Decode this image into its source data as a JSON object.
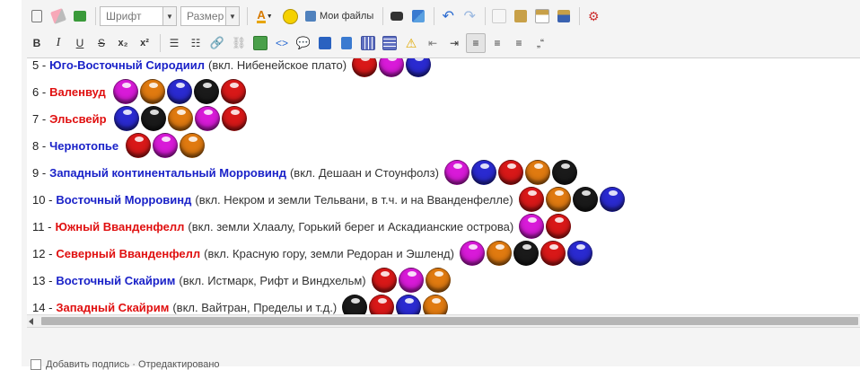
{
  "toolbar1": {
    "font_placeholder": "Шрифт",
    "size_placeholder": "Размер",
    "my_files_label": "Мои файлы"
  },
  "toolbar2": {
    "bold": "B",
    "italic": "I",
    "underline": "U",
    "strike": "S",
    "subscript": "x₂",
    "superscript": "x²",
    "quote": "„“"
  },
  "colors": {
    "red": "#d81818",
    "magenta": "#d81ad8",
    "blue": "#2a2ad0",
    "orange": "#e07a10",
    "black": "#1a1a1a",
    "name_blue": "#1a22c8",
    "name_red": "#e01010"
  },
  "lines": [
    {
      "num": "5 - ",
      "name": "Юго-Восточный Сиродиил",
      "color": "blue",
      "note": " (вкл. Нибенейское плато)",
      "balls": [
        "red",
        "magenta",
        "blue"
      ]
    },
    {
      "num": "6 - ",
      "name": "Валенвуд",
      "color": "red",
      "note": "",
      "balls": [
        "magenta",
        "orange",
        "blue",
        "black",
        "red"
      ]
    },
    {
      "num": "7 - ",
      "name": "Эльсвейр",
      "color": "red",
      "note": "",
      "balls": [
        "blue",
        "black",
        "orange",
        "magenta",
        "red"
      ]
    },
    {
      "num": "8 - ",
      "name": "Чернотопье",
      "color": "blue",
      "note": "",
      "balls": [
        "red",
        "magenta",
        "orange"
      ]
    },
    {
      "num": "9 - ",
      "name": "Западный континентальный Морровинд",
      "color": "blue",
      "note": " (вкл. Дешаан и Стоунфолз)",
      "balls": [
        "magenta",
        "blue",
        "red",
        "orange",
        "black"
      ]
    },
    {
      "num": "10 - ",
      "name": "Восточный Морровинд",
      "color": "blue",
      "note": " (вкл. Некром и земли Тельвани, в т.ч. и на Вванденфелле)",
      "balls": [
        "red",
        "orange",
        "black",
        "blue"
      ]
    },
    {
      "num": "11 - ",
      "name": "Южный Вванденфелл",
      "color": "red",
      "note": " (вкл. земли Хлаалу, Горький берег и Аскадианские острова)",
      "balls": [
        "magenta",
        "red"
      ]
    },
    {
      "num": "12 - ",
      "name": "Северный Вванденфелл",
      "color": "red",
      "note": " (вкл. Красную гору, земли Редоран и Эшленд)",
      "balls": [
        "magenta",
        "orange",
        "black",
        "red",
        "blue"
      ]
    },
    {
      "num": "13 - ",
      "name": "Восточный Скайрим",
      "color": "blue",
      "note": " (вкл. Истмарк, Рифт и Виндхельм)",
      "balls": [
        "red",
        "magenta",
        "orange"
      ]
    },
    {
      "num": "14 - ",
      "name": "Западный Скайрим",
      "color": "red",
      "note": " (вкл. Вайтран, Пределы и т.д.)",
      "balls": [
        "black",
        "red",
        "blue",
        "orange"
      ]
    }
  ],
  "footer": {
    "checkbox_label": "Добавить подпись · Отредактировано"
  }
}
